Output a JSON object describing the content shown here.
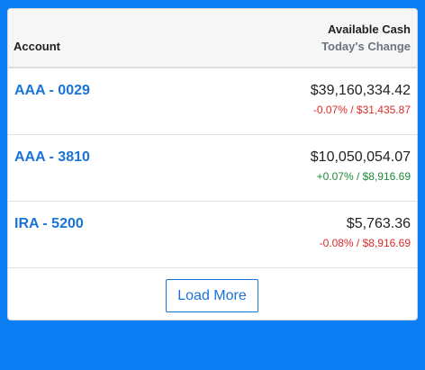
{
  "header": {
    "account_label": "Account",
    "cash_label": "Available Cash",
    "change_label": "Today's Change"
  },
  "accounts": [
    {
      "name": "AAA - 0029",
      "balance": "$39,160,334.42",
      "change": "-0.07% / $31,435.87",
      "direction": "negative"
    },
    {
      "name": "AAA - 3810",
      "balance": "$10,050,054.07",
      "change": "+0.07% / $8,916.69",
      "direction": "positive"
    },
    {
      "name": "IRA - 5200",
      "balance": "$5,763.36",
      "change": "-0.08% / $8,916.69",
      "direction": "negative"
    }
  ],
  "footer": {
    "load_more_label": "Load More"
  },
  "colors": {
    "background": "#0a7ef2",
    "link": "#1a73d6",
    "negative": "#dc2b2b",
    "positive": "#1f8a3a"
  }
}
